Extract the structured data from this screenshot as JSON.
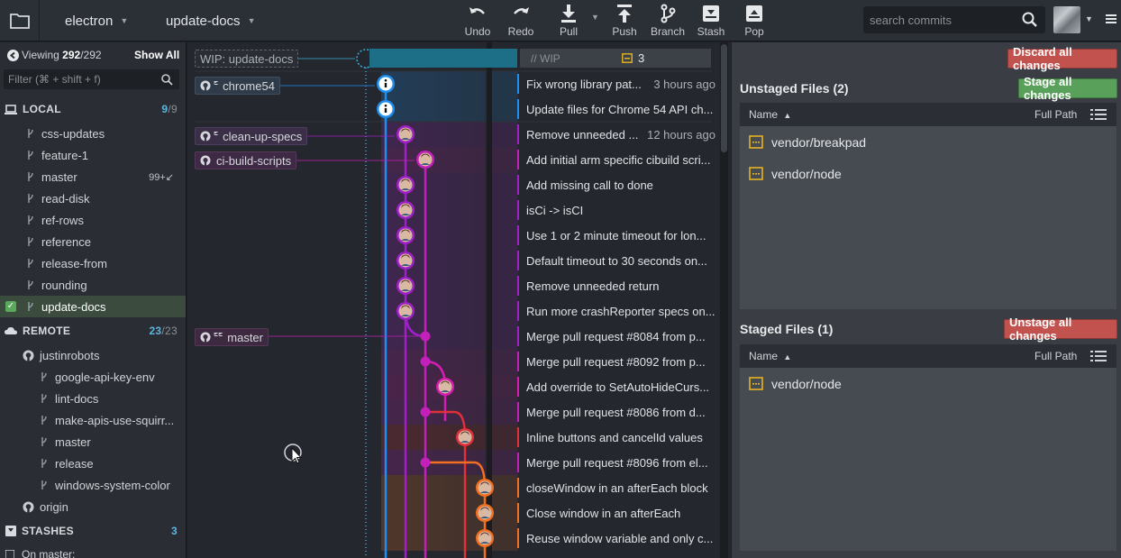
{
  "toolbar": {
    "repo": "electron",
    "branch": "update-docs",
    "buttons": [
      {
        "id": "undo",
        "label": "Undo",
        "icon": "undo-icon"
      },
      {
        "id": "redo",
        "label": "Redo",
        "icon": "redo-icon"
      },
      {
        "id": "pull",
        "label": "Pull",
        "icon": "pull-icon"
      },
      {
        "id": "push",
        "label": "Push",
        "icon": "push-icon"
      },
      {
        "id": "branch",
        "label": "Branch",
        "icon": "branch-icon"
      },
      {
        "id": "stash",
        "label": "Stash",
        "icon": "stash-icon"
      },
      {
        "id": "pop",
        "label": "Pop",
        "icon": "pop-icon"
      }
    ],
    "search_placeholder": "search commits"
  },
  "sidebar": {
    "viewing_label": "Viewing",
    "viewing_count": "292",
    "viewing_total": "/292",
    "show_all": "Show All",
    "filter_placeholder": "Filter (⌘ + shift + f)",
    "local": {
      "title": "LOCAL",
      "count": "9",
      "total": "/9",
      "branches": [
        "css-updates",
        "feature-1",
        "master",
        "read-disk",
        "ref-rows",
        "reference",
        "release-from",
        "rounding",
        "update-docs"
      ],
      "master_badge": "99+↙"
    },
    "remote": {
      "title": "REMOTE",
      "count": "23",
      "total": "/23",
      "remote_name": "justinrobots",
      "branches": [
        "google-api-key-env",
        "lint-docs",
        "make-apis-use-squirr...",
        "master",
        "release",
        "windows-system-color"
      ],
      "origin": "origin"
    },
    "stashes": {
      "title": "STASHES",
      "count": "3",
      "first": "On master:"
    }
  },
  "graph": {
    "wip_ref": "WIP: update-docs",
    "wip_label": "// WIP",
    "wip_count": "3",
    "refs": [
      "chrome54",
      "clean-up-specs",
      "ci-build-scripts",
      "master"
    ],
    "commits": [
      {
        "message": "Fix wrong library pat...",
        "time": "3 hours ago"
      },
      {
        "message": "Update files for Chrome 54 API ch...",
        "time": ""
      },
      {
        "message": "Remove unneeded ...",
        "time": "12 hours ago"
      },
      {
        "message": "Add initial arm specific cibuild scri...",
        "time": ""
      },
      {
        "message": "Add missing call to done",
        "time": ""
      },
      {
        "message": "isCi -> isCI",
        "time": ""
      },
      {
        "message": "Use 1 or 2 minute timeout for lon...",
        "time": ""
      },
      {
        "message": "Default timeout to 30 seconds on...",
        "time": ""
      },
      {
        "message": "Remove unneeded return",
        "time": ""
      },
      {
        "message": "Run more crashReporter specs on...",
        "time": ""
      },
      {
        "message": "Merge pull request #8084 from p...",
        "time": ""
      },
      {
        "message": "Merge pull request #8092 from p...",
        "time": ""
      },
      {
        "message": "Add override to SetAutoHideCurs...",
        "time": ""
      },
      {
        "message": "Merge pull request #8086 from d...",
        "time": ""
      },
      {
        "message": "Inline buttons and cancelId values",
        "time": ""
      },
      {
        "message": "Merge pull request #8096 from el...",
        "time": ""
      },
      {
        "message": "closeWindow in an afterEach block",
        "time": ""
      },
      {
        "message": "Close window in an afterEach",
        "time": ""
      },
      {
        "message": "Reuse window variable and only c...",
        "time": ""
      }
    ]
  },
  "right": {
    "discard_all": "Discard all changes",
    "unstaged_title": "Unstaged Files (2)",
    "stage_all": "Stage all changes",
    "name_col": "Name",
    "path_col": "Full Path",
    "unstaged_files": [
      "vendor/breakpad",
      "vendor/node"
    ],
    "staged_title": "Staged Files (1)",
    "unstage_all": "Unstage all changes",
    "staged_files": [
      "vendor/node"
    ]
  },
  "colors": {
    "accent_blue": "#5bb6e0",
    "lane_blue": "#1f8ef1",
    "lane_purple": "#a020c8",
    "lane_magenta": "#d81bb2",
    "lane_red": "#e0313a",
    "lane_orange": "#f06f22",
    "discard_red": "#c1524e",
    "stage_green": "#59a15a",
    "modified_yellow": "#e6b422"
  }
}
